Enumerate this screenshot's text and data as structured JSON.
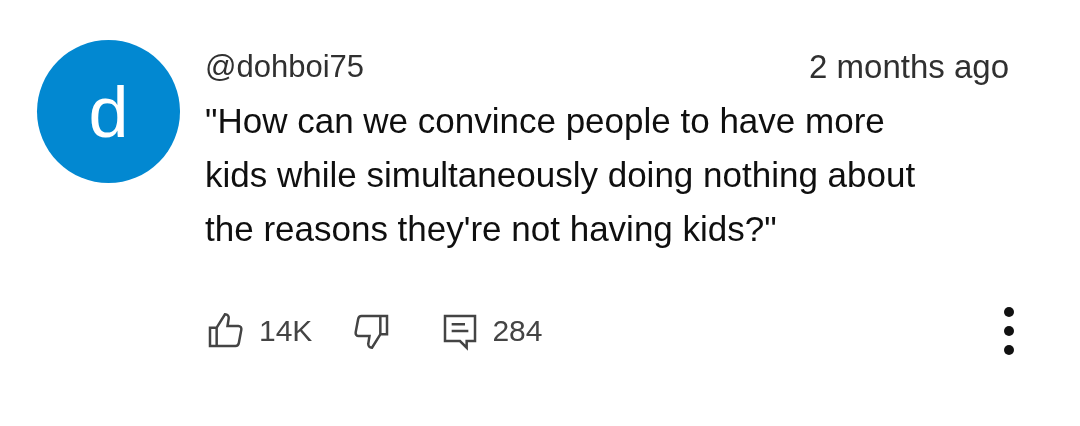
{
  "comment": {
    "avatar_letter": "d",
    "author": "@dohboi75",
    "time": "2 months ago",
    "text": "\"How can we convince people to have more kids while simultaneously doing nothing about the reasons they're not having kids?\"",
    "likes": "14K",
    "replies": "284"
  }
}
